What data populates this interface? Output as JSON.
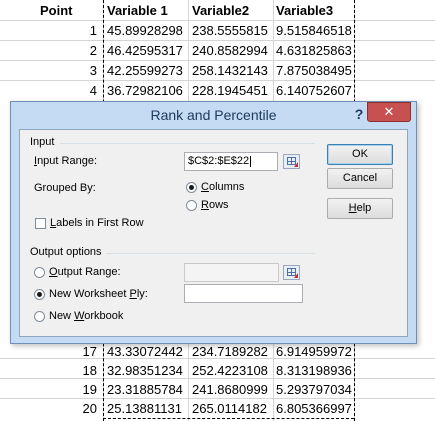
{
  "sheet": {
    "headers": [
      "Point",
      "Variable 1",
      "Variable2",
      "Variable3"
    ],
    "top_rows": [
      {
        "point": "1",
        "v1": "45.89928298",
        "v2": "238.5555815",
        "v3": "9.515846518"
      },
      {
        "point": "2",
        "v1": "46.42595317",
        "v2": "240.8582994",
        "v3": "4.631825863"
      },
      {
        "point": "3",
        "v1": "42.25599273",
        "v2": "258.1432143",
        "v3": "7.875038495"
      },
      {
        "point": "4",
        "v1": "36.72982106",
        "v2": "228.1945451",
        "v3": "6.140752607"
      }
    ],
    "bottom_rows": [
      {
        "point": "17",
        "v1": "43.33072442",
        "v2": "234.7189282",
        "v3": "6.914959972"
      },
      {
        "point": "18",
        "v1": "32.98351234",
        "v2": "252.4223108",
        "v3": "8.313198936"
      },
      {
        "point": "19",
        "v1": "23.31885784",
        "v2": "241.8680999",
        "v3": "5.293797034"
      },
      {
        "point": "20",
        "v1": "25.13881131",
        "v2": "265.0114182",
        "v3": "6.805366997"
      }
    ]
  },
  "dialog": {
    "title": "Rank and Percentile",
    "help_glyph": "?",
    "close_glyph": "✕",
    "input": {
      "section_label": "Input",
      "input_range_label": "Input Range:",
      "input_range_value": "$C$2:$E$22",
      "grouped_by_label": "Grouped By:",
      "columns_label": "Columns",
      "rows_label": "Rows",
      "grouped_by_selected": "Columns",
      "labels_first_row_label": "Labels in First Row",
      "labels_first_row_checked": false
    },
    "output": {
      "section_label": "Output options",
      "output_range_label": "Output Range:",
      "new_worksheet_label": "New Worksheet Ply:",
      "new_workbook_label": "New Workbook",
      "selected": "New Worksheet Ply",
      "output_range_value": "",
      "new_worksheet_value": ""
    },
    "buttons": {
      "ok": "OK",
      "cancel": "Cancel",
      "help": "Help"
    }
  },
  "colors": {
    "dialog_frame": "#c4dbf3",
    "close_button": "#c75050",
    "title_text": "#1e395b"
  }
}
